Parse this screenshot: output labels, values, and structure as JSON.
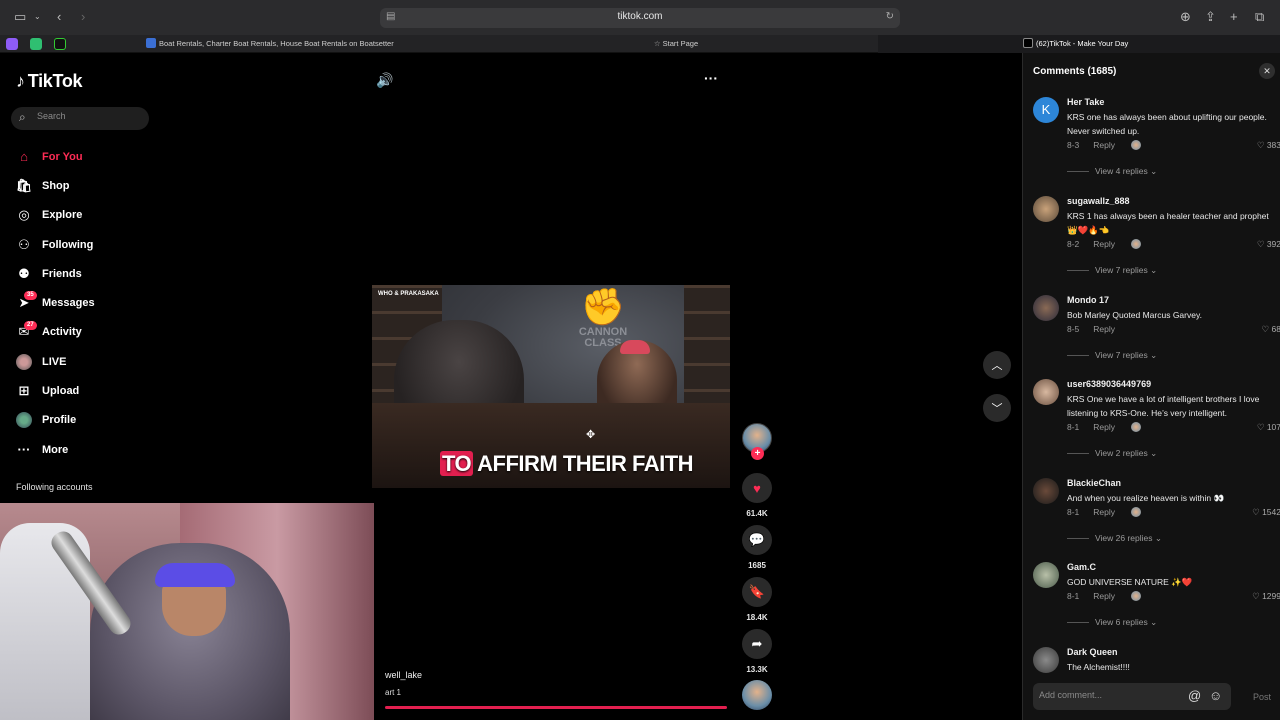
{
  "browser": {
    "url": "tiktok.com",
    "tabs": [
      {
        "label": "Boat Rentals, Charter Boat Rentals, House Boat Rentals on Boatsetter"
      },
      {
        "label": "Start Page"
      },
      {
        "label": "(62)TikTok - Make Your Day"
      }
    ]
  },
  "sidebar": {
    "logo": "TikTok",
    "search_placeholder": "Search",
    "items": [
      {
        "label": "For You",
        "icon": "home-icon"
      },
      {
        "label": "Shop",
        "icon": "shop-icon"
      },
      {
        "label": "Explore",
        "icon": "explore-icon"
      },
      {
        "label": "Following",
        "icon": "following-icon"
      },
      {
        "label": "Friends",
        "icon": "friends-icon"
      },
      {
        "label": "Messages",
        "icon": "messages-icon",
        "badge": "35"
      },
      {
        "label": "Activity",
        "icon": "activity-icon",
        "badge": "27"
      },
      {
        "label": "LIVE",
        "icon": "live-icon"
      },
      {
        "label": "Upload",
        "icon": "upload-icon"
      },
      {
        "label": "Profile",
        "icon": "profile-icon"
      },
      {
        "label": "More",
        "icon": "more-icon"
      }
    ],
    "following_header": "Following accounts"
  },
  "video": {
    "watermark": "WHO & PRAKASAKA",
    "sign_text": "CANNON CLASS",
    "caption_highlight": "TO",
    "caption_rest": "AFFIRM THEIR FAITH",
    "username": "well_lake",
    "description": "art 1"
  },
  "actions": {
    "likes": "61.4K",
    "comments": "1685",
    "saves": "18.4K",
    "shares": "13.3K"
  },
  "comments_panel": {
    "title": "Comments (1685)",
    "comments": [
      {
        "name": "Her Take",
        "text": "KRS one has always been about uplifting our people. Never switched up.",
        "date": "8-3",
        "reply": "Reply",
        "likes": "383",
        "views": "View 4 replies",
        "avatar_letter": "K"
      },
      {
        "name": "sugawallz_888",
        "text": "KRS 1 has always been a healer teacher and prophet 👑❤️🔥👈",
        "date": "8-2",
        "reply": "Reply",
        "likes": "392",
        "views": "View 7 replies"
      },
      {
        "name": "Mondo 17",
        "text": "Bob Marley Quoted Marcus Garvey.",
        "date": "8-5",
        "reply": "Reply",
        "likes": "68",
        "views": "View 7 replies"
      },
      {
        "name": "user6389036449769",
        "text": "KRS One we have a lot of intelligent brothers I love listening to KRS-One. He’s very intelligent.",
        "date": "8-1",
        "reply": "Reply",
        "likes": "107",
        "views": "View 2 replies"
      },
      {
        "name": "BlackieChan",
        "text": "And when you realize heaven is within 👀",
        "date": "8-1",
        "reply": "Reply",
        "likes": "1542",
        "views": "View 26 replies"
      },
      {
        "name": "Gam.C",
        "text": "GOD UNIVERSE NATURE ✨❤️",
        "date": "8-1",
        "reply": "Reply",
        "likes": "1299",
        "views": "View 6 replies"
      },
      {
        "name": "Dark Queen",
        "text": "The Alchemist!!!!"
      }
    ],
    "input_placeholder": "Add comment...",
    "post_label": "Post"
  }
}
